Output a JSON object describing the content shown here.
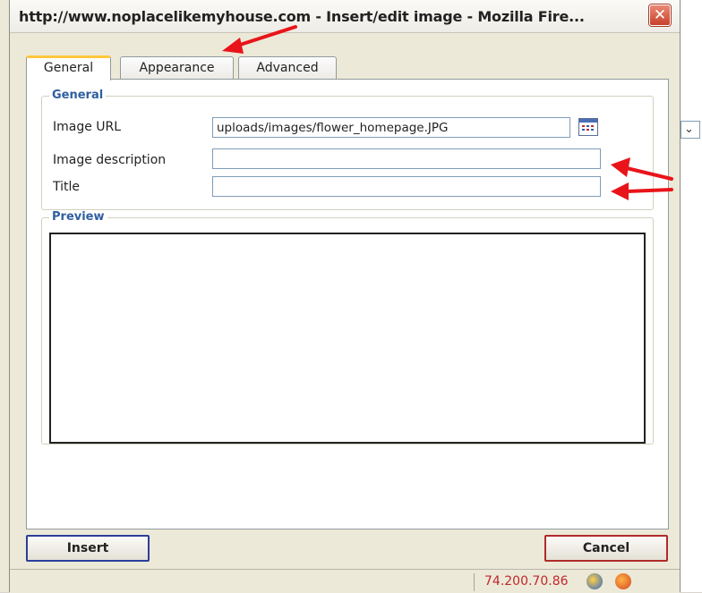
{
  "window": {
    "title": "http://www.noplacelikemyhouse.com - Insert/edit image - Mozilla Fire...",
    "close_glyph": "✕"
  },
  "tabs": [
    {
      "label": "General",
      "active": true
    },
    {
      "label": "Appearance",
      "active": false
    },
    {
      "label": "Advanced",
      "active": false
    }
  ],
  "general": {
    "legend": "General",
    "image_url_label": "Image URL",
    "image_url_value": "uploads/images/flower_homepage.JPG",
    "image_description_label": "Image description",
    "image_description_value": "",
    "title_label": "Title",
    "title_value": ""
  },
  "preview": {
    "legend": "Preview"
  },
  "buttons": {
    "insert": "Insert",
    "cancel": "Cancel"
  },
  "statusbar": {
    "ip": "74.200.70.86"
  },
  "background": {
    "select_glyph": "⌄"
  },
  "colors": {
    "accent_legend": "#2f5fa0",
    "annotation_arrow": "#e8141a",
    "active_tab_top": "#ffc83c"
  }
}
